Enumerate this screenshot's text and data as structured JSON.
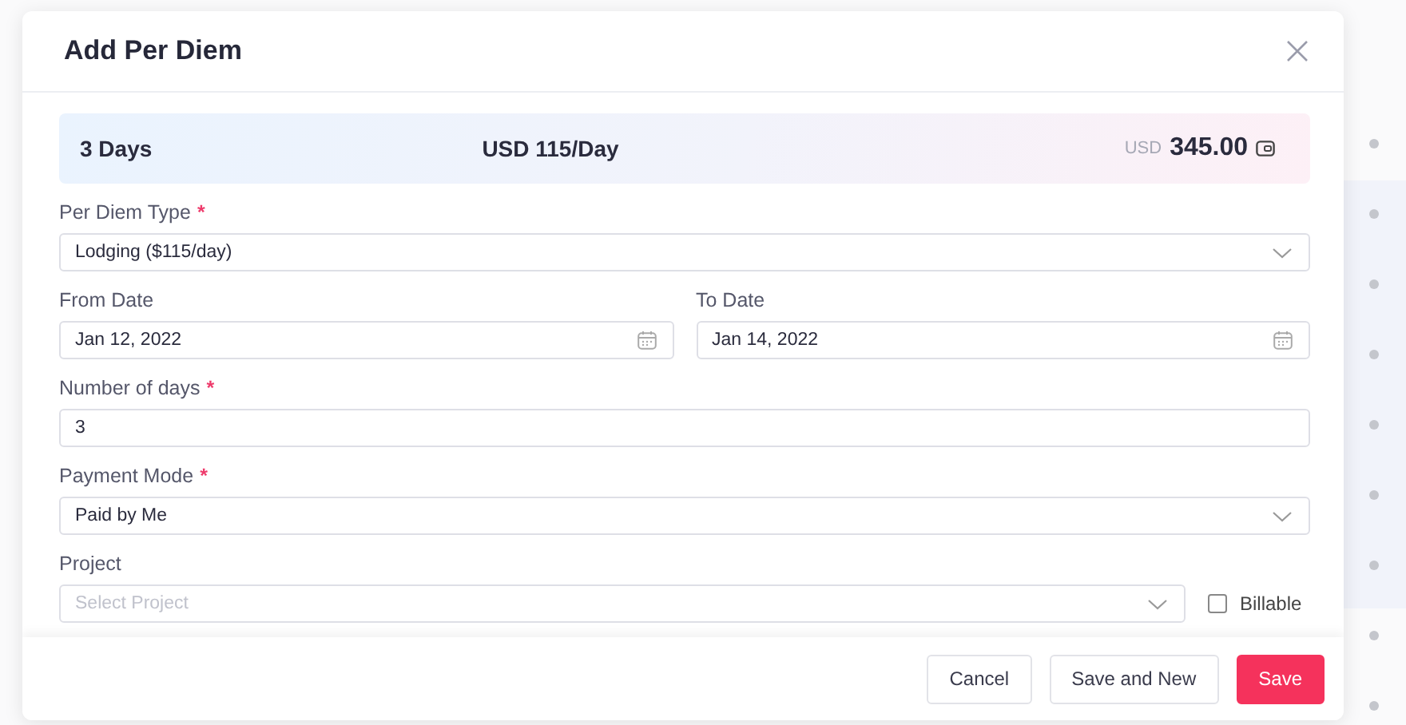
{
  "dialog": {
    "title": "Add Per Diem"
  },
  "summary": {
    "days": "3 Days",
    "rate": "USD 115/Day",
    "currency": "USD",
    "total": "345.00"
  },
  "fields": [
    {
      "kind": "select",
      "label": "Per Diem Type",
      "required_mark": "*",
      "value": "Lodging ($115/day)"
    },
    {
      "kind": "dates",
      "items": [
        {
          "label": "From Date",
          "value": "Jan 12, 2022"
        },
        {
          "label": "To Date",
          "value": "Jan 14, 2022"
        }
      ]
    },
    {
      "kind": "text",
      "label": "Number of days",
      "required_mark": "*",
      "value": "3"
    },
    {
      "kind": "select",
      "label": "Payment Mode",
      "required_mark": "*",
      "value": "Paid by Me"
    },
    {
      "kind": "project",
      "label": "Project",
      "placeholder": "Select Project",
      "billable": {
        "label": "Billable",
        "checked": false
      }
    }
  ],
  "buttons": [
    {
      "label": "Cancel",
      "kind": "secondary"
    },
    {
      "label": "Save and New",
      "kind": "secondary"
    },
    {
      "label": "Save",
      "kind": "primary"
    }
  ]
}
